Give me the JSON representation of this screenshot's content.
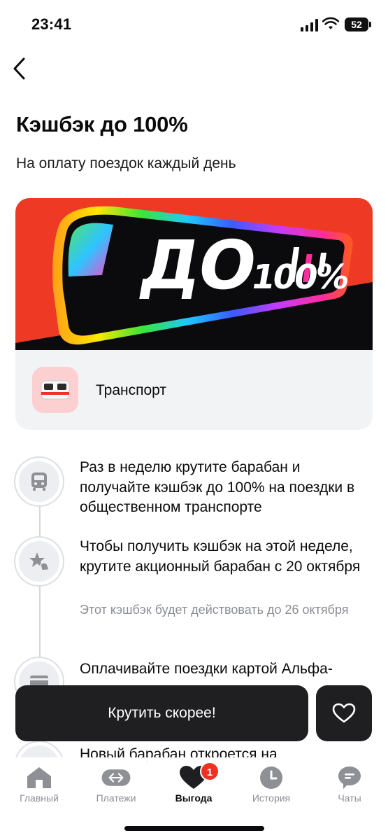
{
  "status_bar": {
    "time": "23:41",
    "battery": "52"
  },
  "header": {
    "back_icon": "chevron-left-icon",
    "title": "Кэшбэк до 100%",
    "subtitle": "На оплату поездок каждый день"
  },
  "banner": {
    "text_big": "ДО",
    "text_percent": "100%",
    "background_color": "#ee3a24"
  },
  "category": {
    "icon": "tram-icon",
    "label": "Транспорт"
  },
  "steps": [
    {
      "icon": "bus-icon",
      "text": "Раз в неделю крутите барабан и получайте кэшбэк до 100% на поездки в общественном транспорте"
    },
    {
      "icon": "star-hand-icon",
      "text": "Чтобы получить кэшбэк на этой неделе, крутите акционный барабан с 20 октября",
      "note": "Этот кэшбэк будет действовать до 26 октября"
    },
    {
      "icon": "card-icon",
      "text": "Оплачивайте поездки картой Альфа-"
    },
    {
      "icon": "calendar-icon",
      "text": "Новый барабан откроется на"
    }
  ],
  "actions": {
    "primary_label": "Крутить скорее!",
    "favorite_icon": "heart-icon"
  },
  "tab_bar": {
    "items": [
      {
        "label": "Главный",
        "icon": "home-icon"
      },
      {
        "label": "Платежи",
        "icon": "transfer-icon"
      },
      {
        "label": "Выгода",
        "icon": "heart-icon",
        "badge": "1",
        "active": true
      },
      {
        "label": "История",
        "icon": "clock-icon"
      },
      {
        "label": "Чаты",
        "icon": "chat-icon"
      }
    ]
  },
  "colors": {
    "accent": "#ef3124",
    "dark_button": "#1f1f22",
    "muted_text": "#8a8d94"
  }
}
